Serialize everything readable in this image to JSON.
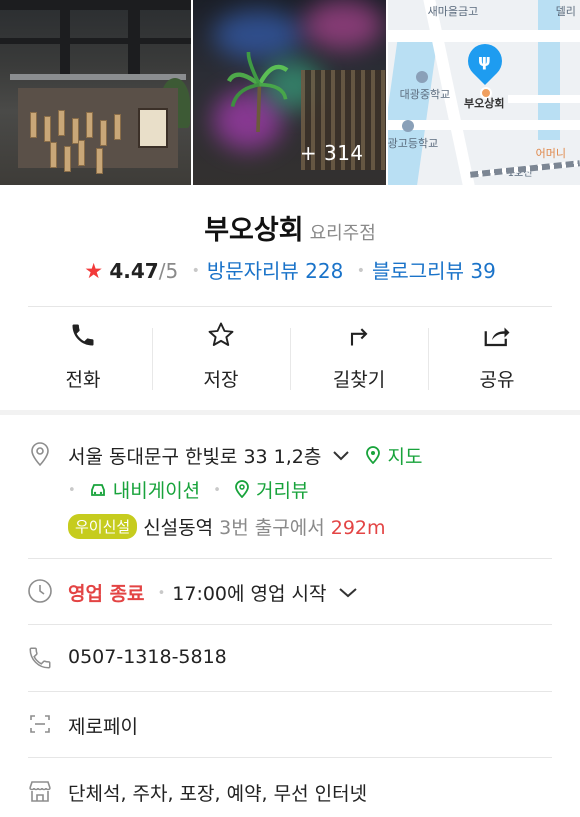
{
  "photos": {
    "more_count": "+ 314"
  },
  "map": {
    "labels": [
      "새마을금고",
      "델리",
      "대광중학교",
      "부오상회",
      "광고등학교",
      "어머니",
      "1호선"
    ]
  },
  "place": {
    "name": "부오상회",
    "category": "요리주점",
    "rating": "4.47",
    "rating_max": "/5",
    "visitor_reviews": "방문자리뷰 228",
    "blog_reviews": "블로그리뷰 39"
  },
  "actions": {
    "call": "전화",
    "save": "저장",
    "directions": "길찾기",
    "share": "공유"
  },
  "address": {
    "text": "서울 동대문구 한빛로 33 1,2층",
    "map_link": "지도",
    "navigation_link": "내비게이션",
    "street_view_link": "거리뷰",
    "station_badge": "우이신설",
    "station": "신설동역",
    "exit": "3번 출구에서",
    "distance": "292m"
  },
  "hours": {
    "status": "영업 종료",
    "next": "17:00에 영업 시작"
  },
  "phone": "0507-1318-5818",
  "payment": "제로페이",
  "amenities": "단체석, 주차, 포장, 예약, 무선 인터넷",
  "colors": {
    "accent_blue": "#1a73c9",
    "green": "#18a33b",
    "red": "#e34444",
    "badge": "#c6cc1e",
    "star": "#f23a3a"
  }
}
